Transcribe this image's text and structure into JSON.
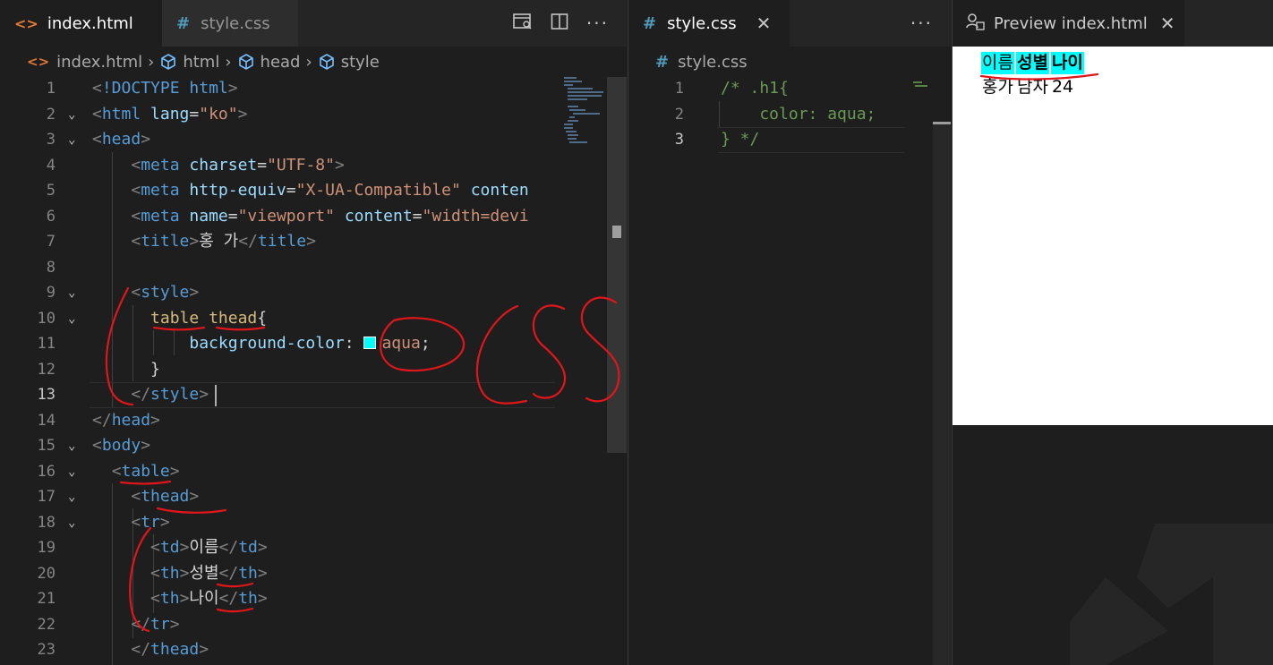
{
  "editor_left": {
    "tabs": [
      {
        "label": "index.html",
        "icon": "html-file-icon",
        "active": true,
        "dirty": true
      },
      {
        "label": "style.css",
        "icon": "css-file-icon",
        "active": false,
        "dirty": false
      }
    ],
    "actions": [
      "open-preview-icon",
      "split-editor-icon",
      "more-actions-icon"
    ],
    "breadcrumb": [
      "index.html",
      "html",
      "head",
      "style"
    ],
    "current_line": 13,
    "lines": [
      {
        "n": "1",
        "fold": "",
        "tokens": [
          [
            "punc",
            "<"
          ],
          [
            "tag",
            "!DOCTYPE "
          ],
          [
            "tag",
            "html"
          ],
          [
            "punc",
            ">"
          ]
        ]
      },
      {
        "n": "2",
        "fold": "v",
        "tokens": [
          [
            "punc",
            "<"
          ],
          [
            "tag",
            "html "
          ],
          [
            "attr",
            "lang"
          ],
          [
            "plain",
            "="
          ],
          [
            "str",
            "\"ko\""
          ],
          [
            "punc",
            ">"
          ]
        ]
      },
      {
        "n": "3",
        "fold": "v",
        "tokens": [
          [
            "punc",
            "<"
          ],
          [
            "tag",
            "head"
          ],
          [
            "punc",
            ">"
          ]
        ]
      },
      {
        "n": "4",
        "fold": "",
        "tokens": [
          [
            "plain",
            "    "
          ],
          [
            "punc",
            "<"
          ],
          [
            "tag",
            "meta "
          ],
          [
            "attr",
            "charset"
          ],
          [
            "plain",
            "="
          ],
          [
            "str",
            "\"UTF-8\""
          ],
          [
            "punc",
            ">"
          ]
        ]
      },
      {
        "n": "5",
        "fold": "",
        "tokens": [
          [
            "plain",
            "    "
          ],
          [
            "punc",
            "<"
          ],
          [
            "tag",
            "meta "
          ],
          [
            "attr",
            "http-equiv"
          ],
          [
            "plain",
            "="
          ],
          [
            "str",
            "\"X-UA-Compatible\""
          ],
          [
            "plain",
            " "
          ],
          [
            "attr",
            "conten"
          ]
        ]
      },
      {
        "n": "6",
        "fold": "",
        "tokens": [
          [
            "plain",
            "    "
          ],
          [
            "punc",
            "<"
          ],
          [
            "tag",
            "meta "
          ],
          [
            "attr",
            "name"
          ],
          [
            "plain",
            "="
          ],
          [
            "str",
            "\"viewport\""
          ],
          [
            "plain",
            " "
          ],
          [
            "attr",
            "content"
          ],
          [
            "plain",
            "="
          ],
          [
            "str",
            "\"width=devi"
          ]
        ]
      },
      {
        "n": "7",
        "fold": "",
        "tokens": [
          [
            "plain",
            "    "
          ],
          [
            "punc",
            "<"
          ],
          [
            "tag",
            "title"
          ],
          [
            "punc",
            ">"
          ],
          [
            "plain",
            "홍 가"
          ],
          [
            "punc",
            "</"
          ],
          [
            "tag",
            "title"
          ],
          [
            "punc",
            ">"
          ]
        ]
      },
      {
        "n": "8",
        "fold": "",
        "tokens": []
      },
      {
        "n": "9",
        "fold": "v",
        "tokens": [
          [
            "plain",
            "    "
          ],
          [
            "punc",
            "<"
          ],
          [
            "tag",
            "style"
          ],
          [
            "punc",
            ">"
          ]
        ]
      },
      {
        "n": "10",
        "fold": "v",
        "tokens": [
          [
            "plain",
            "      "
          ],
          [
            "sel",
            "table"
          ],
          [
            "plain",
            " "
          ],
          [
            "sel",
            "thead"
          ],
          [
            "plain",
            "{"
          ]
        ]
      },
      {
        "n": "11",
        "fold": "",
        "tokens": [
          [
            "plain",
            "          "
          ],
          [
            "prop",
            "background-color"
          ],
          [
            "plain",
            ": "
          ],
          [
            "swatch",
            ""
          ],
          [
            "val",
            "aqua"
          ],
          [
            "plain",
            ";"
          ]
        ]
      },
      {
        "n": "12",
        "fold": "",
        "tokens": [
          [
            "plain",
            "      }"
          ]
        ]
      },
      {
        "n": "13",
        "fold": "",
        "tokens": [
          [
            "plain",
            "    "
          ],
          [
            "punc",
            "</"
          ],
          [
            "tag",
            "style"
          ],
          [
            "punc",
            ">"
          ]
        ]
      },
      {
        "n": "14",
        "fold": "",
        "tokens": [
          [
            "punc",
            "</"
          ],
          [
            "tag",
            "head"
          ],
          [
            "punc",
            ">"
          ]
        ]
      },
      {
        "n": "15",
        "fold": "v",
        "tokens": [
          [
            "punc",
            "<"
          ],
          [
            "tag",
            "body"
          ],
          [
            "punc",
            ">"
          ]
        ]
      },
      {
        "n": "16",
        "fold": "v",
        "tokens": [
          [
            "plain",
            "  "
          ],
          [
            "punc",
            "<"
          ],
          [
            "tag",
            "table"
          ],
          [
            "punc",
            ">"
          ]
        ]
      },
      {
        "n": "17",
        "fold": "v",
        "tokens": [
          [
            "plain",
            "    "
          ],
          [
            "punc",
            "<"
          ],
          [
            "tag",
            "thead"
          ],
          [
            "punc",
            ">"
          ]
        ]
      },
      {
        "n": "18",
        "fold": "v",
        "tokens": [
          [
            "plain",
            "    "
          ],
          [
            "punc",
            "<"
          ],
          [
            "tag",
            "tr"
          ],
          [
            "punc",
            ">"
          ]
        ]
      },
      {
        "n": "19",
        "fold": "",
        "tokens": [
          [
            "plain",
            "      "
          ],
          [
            "punc",
            "<"
          ],
          [
            "tag",
            "td"
          ],
          [
            "punc",
            ">"
          ],
          [
            "plain",
            "이름"
          ],
          [
            "punc",
            "</"
          ],
          [
            "tag",
            "td"
          ],
          [
            "punc",
            ">"
          ]
        ]
      },
      {
        "n": "20",
        "fold": "",
        "tokens": [
          [
            "plain",
            "      "
          ],
          [
            "punc",
            "<"
          ],
          [
            "tag",
            "th"
          ],
          [
            "punc",
            ">"
          ],
          [
            "plain",
            "성별"
          ],
          [
            "punc",
            "</"
          ],
          [
            "tag",
            "th"
          ],
          [
            "punc",
            ">"
          ]
        ]
      },
      {
        "n": "21",
        "fold": "",
        "tokens": [
          [
            "plain",
            "      "
          ],
          [
            "punc",
            "<"
          ],
          [
            "tag",
            "th"
          ],
          [
            "punc",
            ">"
          ],
          [
            "plain",
            "나이"
          ],
          [
            "punc",
            "</"
          ],
          [
            "tag",
            "th"
          ],
          [
            "punc",
            ">"
          ]
        ]
      },
      {
        "n": "22",
        "fold": "",
        "tokens": [
          [
            "plain",
            "    "
          ],
          [
            "punc",
            "</"
          ],
          [
            "tag",
            "tr"
          ],
          [
            "punc",
            ">"
          ]
        ]
      },
      {
        "n": "23",
        "fold": "",
        "tokens": [
          [
            "plain",
            "    "
          ],
          [
            "punc",
            "</"
          ],
          [
            "tag",
            "thead"
          ],
          [
            "punc",
            ">"
          ]
        ]
      }
    ]
  },
  "editor_middle": {
    "tab": {
      "label": "style.css",
      "icon": "css-file-icon"
    },
    "breadcrumb": "style.css",
    "current_line": 3,
    "lines": [
      {
        "n": "1",
        "tokens": [
          [
            "comment",
            "/* .h1{"
          ]
        ]
      },
      {
        "n": "2",
        "tokens": [
          [
            "comment",
            "    color: aqua;"
          ]
        ]
      },
      {
        "n": "3",
        "tokens": [
          [
            "comment",
            "} */"
          ]
        ]
      }
    ]
  },
  "preview": {
    "tab_label": "Preview index.html",
    "table": {
      "head": [
        {
          "text": "이름",
          "cell": "td"
        },
        {
          "text": "성별",
          "cell": "th"
        },
        {
          "text": "나이",
          "cell": "th"
        }
      ],
      "row": [
        "홍가",
        "남자",
        "24"
      ]
    }
  },
  "handwriting": "CSS",
  "colors": {
    "editor_bg": "#1e1e1e",
    "tabbar_bg": "#252526",
    "aqua": "#00ffff",
    "annotation_red": "#e0161a"
  }
}
